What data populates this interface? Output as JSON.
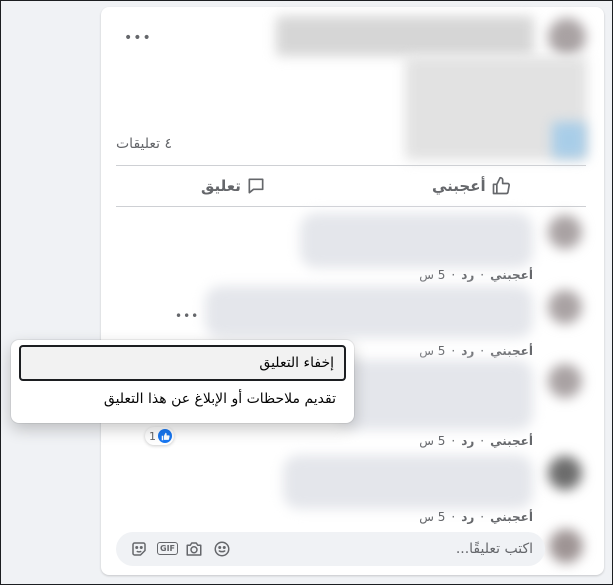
{
  "post": {
    "comments_count": "٤ تعليقات",
    "like_label": "أعجبني",
    "comment_label": "تعليق"
  },
  "comments": [
    {
      "like": "أعجبني",
      "reply": "رد",
      "time": "5 س"
    },
    {
      "like": "أعجبني",
      "reply": "رد",
      "time": "5 س"
    },
    {
      "like": "أعجبني",
      "reply": "رد",
      "time": "5 س"
    },
    {
      "like": "أعجبني",
      "reply": "رد",
      "time": "5 س"
    }
  ],
  "menu": {
    "hide": "إخفاء التعليق",
    "report": "تقديم ملاحظات أو الإبلاغ عن هذا التعليق"
  },
  "reaction": {
    "count": "1",
    "icon": "like-icon",
    "color": "#1877f2"
  },
  "composer": {
    "placeholder": "اكتب تعليقًا...",
    "gif_label": "GIF"
  },
  "colors": {
    "accent": "#1877f2",
    "secondary_text": "#65676b",
    "background": "#f0f2f5"
  }
}
